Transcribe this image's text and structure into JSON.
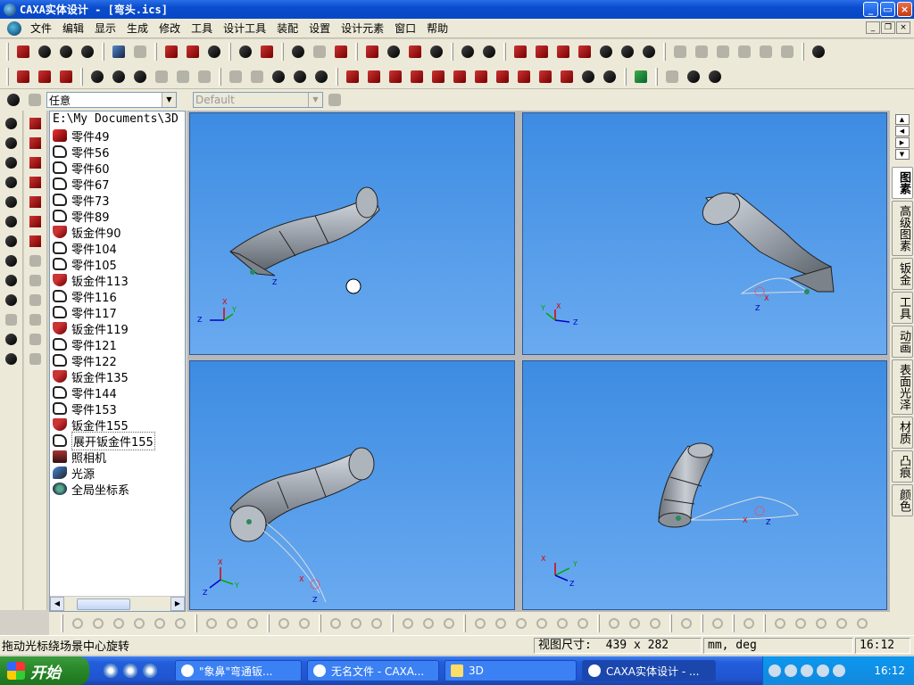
{
  "window": {
    "title": "CAXA实体设计 - [弯头.ics]"
  },
  "menu": [
    "文件",
    "编辑",
    "显示",
    "生成",
    "修改",
    "工具",
    "设计工具",
    "装配",
    "设置",
    "设计元素",
    "窗口",
    "帮助"
  ],
  "toolbar": {
    "selection_filter": "任意",
    "style_combo": "Default"
  },
  "tree": {
    "path": "E:\\My Documents\\3D",
    "items": [
      {
        "label": "零件49",
        "icon": "part-icon"
      },
      {
        "label": "零件56",
        "icon": "open-part-icon"
      },
      {
        "label": "零件60",
        "icon": "open-part-icon"
      },
      {
        "label": "零件67",
        "icon": "open-part-icon"
      },
      {
        "label": "零件73",
        "icon": "open-part-icon"
      },
      {
        "label": "零件89",
        "icon": "open-part-icon"
      },
      {
        "label": "钣金件90",
        "icon": "sheet-metal-icon"
      },
      {
        "label": "零件104",
        "icon": "open-part-icon"
      },
      {
        "label": "零件105",
        "icon": "open-part-icon"
      },
      {
        "label": "钣金件113",
        "icon": "sheet-metal-icon"
      },
      {
        "label": "零件116",
        "icon": "open-part-icon"
      },
      {
        "label": "零件117",
        "icon": "open-part-icon"
      },
      {
        "label": "钣金件119",
        "icon": "sheet-metal-icon"
      },
      {
        "label": "零件121",
        "icon": "open-part-icon"
      },
      {
        "label": "零件122",
        "icon": "open-part-icon"
      },
      {
        "label": "钣金件135",
        "icon": "sheet-metal-icon"
      },
      {
        "label": "零件144",
        "icon": "open-part-icon"
      },
      {
        "label": "零件153",
        "icon": "open-part-icon"
      },
      {
        "label": "钣金件155",
        "icon": "sheet-metal-icon"
      },
      {
        "label": "展开钣金件155",
        "icon": "unfold-sheet-icon"
      },
      {
        "label": "照相机",
        "icon": "camera-icon"
      },
      {
        "label": "光源",
        "icon": "light-icon"
      },
      {
        "label": "全局坐标系",
        "icon": "axis-icon"
      }
    ]
  },
  "right_tabs": [
    "图素",
    "高级图素",
    "钣金",
    "工具",
    "动画",
    "表面光泽",
    "材质",
    "凸痕",
    "颜色"
  ],
  "axis_labels": {
    "x": "X",
    "y": "Y",
    "z": "Z"
  },
  "status": {
    "message": "拖动光标绕场景中心旋转",
    "view_size_label": "视图尺寸:",
    "view_size_value": "439 x  282",
    "units": "mm, deg",
    "time": "16:12"
  },
  "taskbar": {
    "start": "开始",
    "tasks": [
      "\"象鼻\"弯通钣...",
      "无名文件 - CAXA...",
      "3D",
      "CAXA实体设计 - ..."
    ],
    "clock": "16:12"
  }
}
